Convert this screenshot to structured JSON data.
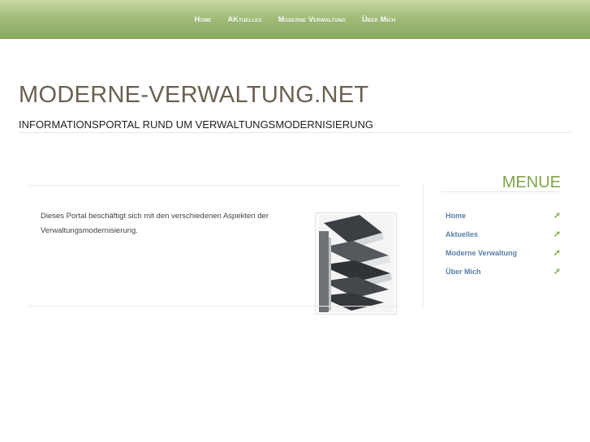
{
  "topnav": {
    "items": [
      "Home",
      "AKtuelles",
      "Moderne Verwaltung",
      "Über Mich"
    ]
  },
  "header": {
    "title": "MODERNE-VERWALTUNG.NET",
    "subtitle": "INFORMATIONSPORTAL RUND UM VERWALTUNGSMODERNISIERUNG"
  },
  "main": {
    "intro_text": "Dieses Portal beschäftigt sich mit den verschiedenen Aspekten der Verwaltungsmodernisierung."
  },
  "sidebar": {
    "title": "MENUE",
    "items": [
      {
        "label": "Home",
        "icon": "arrow-up-right-icon"
      },
      {
        "label": "Aktuelles",
        "icon": "arrow-up-right-icon"
      },
      {
        "label": "Moderne Verwaltung",
        "icon": "arrow-up-right-icon"
      },
      {
        "label": "Über Mich",
        "icon": "arrow-up-right-icon"
      }
    ]
  },
  "colors": {
    "topbar": "#a3bd78",
    "title": "#6b6150",
    "accent_green": "#7fa34c",
    "link_blue": "#5a7fa8"
  }
}
